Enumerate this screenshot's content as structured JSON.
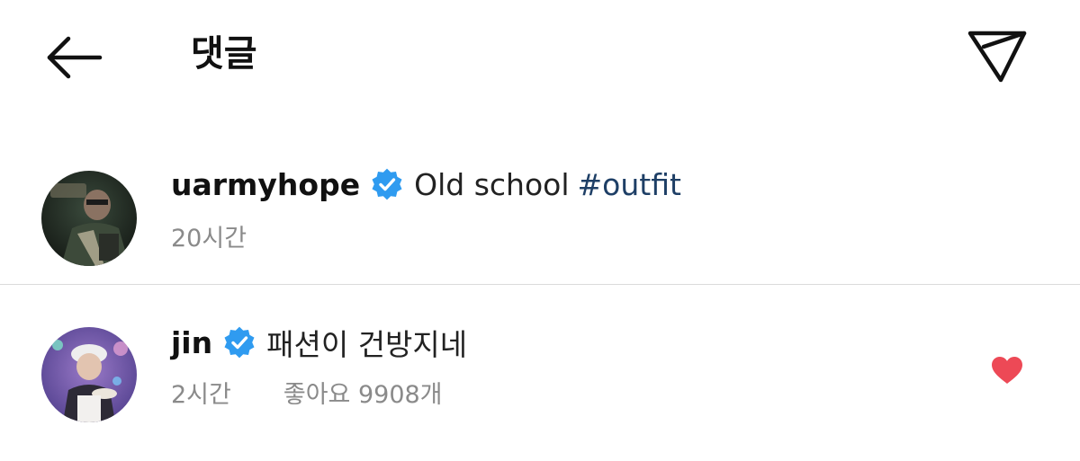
{
  "header": {
    "title": "댓글",
    "back_icon": "arrow-left-icon",
    "share_icon": "paper-plane-icon"
  },
  "comments": [
    {
      "username": "uarmyhope",
      "verified": true,
      "text": "Old school",
      "hashtag": "#outfit",
      "time": "20시간"
    },
    {
      "username": "jin",
      "verified": true,
      "text": "패션이 건방지네",
      "time": "2시간",
      "likes": "좋아요 9908개",
      "liked": true
    }
  ],
  "colors": {
    "verified_blue": "#2f9bf0",
    "hashtag": "#1e3f66",
    "heart": "#ed4956",
    "secondary_text": "#8a8a8a",
    "divider": "#dbdbdb"
  }
}
